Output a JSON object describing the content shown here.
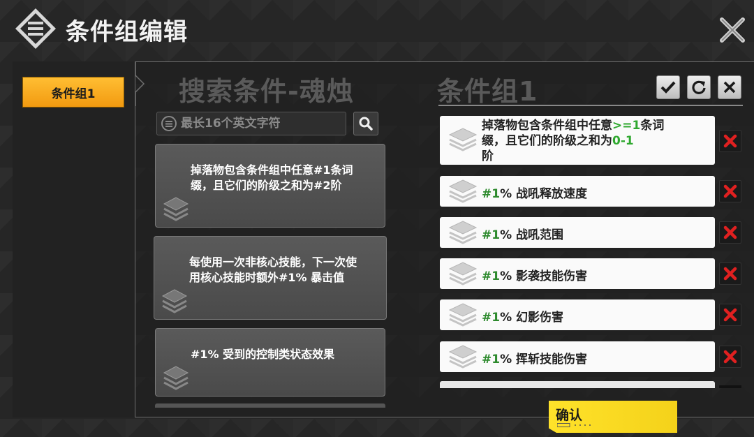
{
  "window": {
    "title": "条件组编辑"
  },
  "sidebar": {
    "tabs": [
      {
        "label": "条件组1",
        "active": true
      }
    ]
  },
  "search_panel": {
    "title": "搜索条件-魂烛",
    "search_placeholder": "最长16个英文字符",
    "results": [
      {
        "text": "掉落物包含条件组中任意#1条词缀，且它们的阶级之和为#2阶"
      },
      {
        "text": "每使用一次非核心技能，下一次使用核心技能时额外#1% 暴击值"
      },
      {
        "text": "#1% 受到的控制类状态效果"
      }
    ]
  },
  "group_panel": {
    "title": "条件组1",
    "header_buttons": [
      "check-icon",
      "reset-icon",
      "close-icon"
    ],
    "first_item": {
      "part1": "掉落物包含条件组中任意",
      "value1": ">=1",
      "part2": "条词缀，且它们的阶级之和为",
      "value2": "0-1",
      "part3": "阶"
    },
    "items": [
      {
        "num": "#1",
        "text": "% 战吼释放速度"
      },
      {
        "num": "#1",
        "text": "% 战吼范围"
      },
      {
        "num": "#1",
        "text": "% 影袭技能伤害"
      },
      {
        "num": "#1",
        "text": "% 幻影伤害"
      },
      {
        "num": "#1",
        "text": "% 挥斩技能伤害"
      }
    ]
  },
  "footer": {
    "confirm_label": "确认"
  },
  "colors": {
    "accent_orange": "#f29a10",
    "confirm_yellow": "#ffe22a",
    "value_green": "#2fa82f",
    "delete_red": "#e02020"
  }
}
